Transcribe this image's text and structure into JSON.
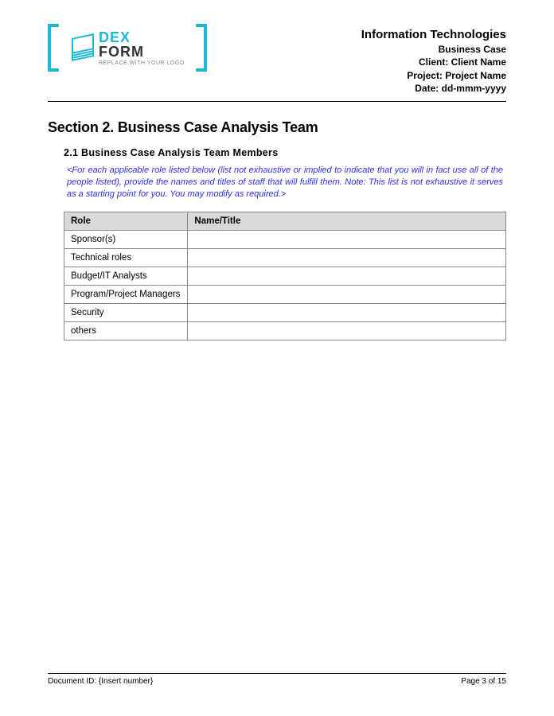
{
  "logo": {
    "line1": "DEX",
    "line2": "FORM",
    "sub": "REPLACE WITH YOUR LOGO"
  },
  "header": {
    "title": "Information Technologies",
    "line2": "Business Case",
    "line3": "Client:  Client Name",
    "line4": "Project: Project Name",
    "line5": "Date: dd-mmm-yyyy"
  },
  "section": {
    "title": "Section 2.  Business Case Analysis Team",
    "sub_title": "2.1  Business Case Analysis Team Members",
    "instruction": "<For each applicable role listed below (list not exhaustive or implied to indicate that you will in fact use all of the people listed), provide the names and titles of staff that will fulfill them. Note:  This list is not exhaustive it serves as a starting point for you.  You may modify as required.>"
  },
  "table": {
    "headers": {
      "col1": "Role",
      "col2": "Name/Title"
    },
    "rows": [
      {
        "role": "Sponsor(s)",
        "name": ""
      },
      {
        "role": "Technical roles",
        "name": ""
      },
      {
        "role": "Budget/IT Analysts",
        "name": ""
      },
      {
        "role": "Program/Project Managers",
        "name": ""
      },
      {
        "role": "Security",
        "name": ""
      },
      {
        "role": "others",
        "name": ""
      }
    ]
  },
  "footer": {
    "doc_id": "Document ID:  {Insert number}",
    "page": "Page 3 of 15"
  }
}
